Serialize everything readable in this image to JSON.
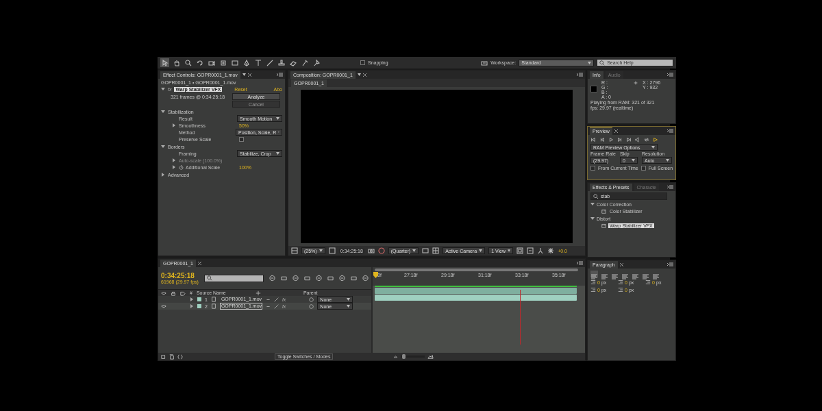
{
  "toolbar": {
    "snapping": {
      "label": "Snapping",
      "checked": false
    },
    "workspace_label": "Workspace:",
    "workspace": "Standard",
    "search": {
      "placeholder": "Search Help"
    }
  },
  "effect_controls": {
    "tab": "Effect Controls: GOPR0001_1.mov",
    "breadcrumb": "GOPR0001_1 • GOPR0001_1.mov",
    "effect_prefix": "fx",
    "effect": "Warp Stabilizer VFX",
    "reset": "Reset",
    "about": "Abo",
    "status": "321 frames @ 0:34:25:18",
    "buttons": [
      {
        "label": "Analyze",
        "disabled": false
      },
      {
        "label": "Cancel",
        "disabled": true
      }
    ],
    "properties": [
      {
        "kind": "group",
        "label": "Stabilization",
        "expanded": true,
        "disabled": false,
        "children": [
          {
            "kind": "dropdown",
            "label": "Result",
            "value": "Smooth Motion",
            "disabled": false
          },
          {
            "kind": "value",
            "label": "Smoothness",
            "value": "50%",
            "expanded": false,
            "disabled": false
          },
          {
            "kind": "dropdown",
            "label": "Method",
            "value": "Position, Scale, R",
            "disabled": false
          },
          {
            "kind": "checkbox",
            "label": "Preserve Scale",
            "checked": false,
            "disabled": false
          }
        ]
      },
      {
        "kind": "group",
        "label": "Borders",
        "expanded": true,
        "disabled": false,
        "children": [
          {
            "kind": "dropdown",
            "label": "Framing",
            "value": "Stabilize, Crop",
            "disabled": false
          },
          {
            "kind": "label",
            "label": "Auto-scale (100.0%)",
            "expanded": false,
            "disabled": true
          },
          {
            "kind": "stopwatch",
            "label": "Additional Scale",
            "value": "100%",
            "expanded": false,
            "disabled": false
          }
        ]
      },
      {
        "kind": "group",
        "label": "Advanced",
        "expanded": false,
        "disabled": false
      }
    ]
  },
  "composition": {
    "tab": "Composition: GOPR0001_1",
    "view_tab": "GOPR0001_1",
    "viewer_bar": {
      "zoom": "(25%)",
      "timecode": "0:34:25:18",
      "resolution": "(Quarter)",
      "view": "Active Camera",
      "layout": "1 View",
      "exposure": "+0.0"
    }
  },
  "info": {
    "tabs": [
      {
        "label": "Info",
        "selected": true
      },
      {
        "label": "Audio",
        "selected": false
      }
    ],
    "channels": [
      "R :",
      "G :",
      "B :",
      "A : 0"
    ],
    "coords": [
      "X : 2796",
      "Y : 932"
    ],
    "status": [
      "Playing from RAM: 321 of 321",
      "fps: 29.97 (realtime)"
    ]
  },
  "preview": {
    "tab": "Preview",
    "options": "RAM Preview Options",
    "fields": [
      {
        "label": "Frame Rate",
        "value": "(29.97)"
      },
      {
        "label": "Skip",
        "value": "0"
      },
      {
        "label": "Resolution",
        "value": "Auto"
      }
    ],
    "checks": [
      {
        "label": "From Current Time",
        "checked": false
      },
      {
        "label": "Full Screen",
        "checked": false
      }
    ]
  },
  "effects": {
    "tabs": [
      {
        "label": "Effects & Presets",
        "selected": true
      },
      {
        "label": "Characte",
        "selected": false
      }
    ],
    "search": "stab",
    "tree": [
      {
        "label": "Color Correction",
        "expanded": true,
        "children": [
          {
            "label": "Color Stabilizer",
            "selected": false
          }
        ]
      },
      {
        "label": "Distort",
        "expanded": true,
        "children": [
          {
            "label": "Warp Stabilizer VFX",
            "selected": true
          }
        ]
      }
    ]
  },
  "paragraph": {
    "tab": "Paragraph",
    "align": [
      {
        "selected": true
      },
      {
        "selected": false
      },
      {
        "selected": false
      },
      {
        "selected": false
      },
      {
        "selected": false
      },
      {
        "selected": false
      },
      {
        "selected": false
      }
    ],
    "spacing": [
      {
        "value": "0",
        "unit": "px"
      },
      {
        "value": "0",
        "unit": "px"
      },
      {
        "value": "0",
        "unit": "px"
      },
      {
        "value": "0",
        "unit": "px"
      },
      {
        "value": "0",
        "unit": "px"
      }
    ]
  },
  "timeline": {
    "tab": "GOPR0001_1",
    "timecode": "0:34:25:18",
    "frame_info": "61968 (29.97 fps)",
    "columns": [
      "#",
      "Source Name",
      "Parent"
    ],
    "layers": [
      {
        "number": "1",
        "name": "GOPR0001_1.mov",
        "effect_switch": "fx",
        "parent": "None",
        "visible": false,
        "selected": false
      },
      {
        "number": "2",
        "name": "GOPR0001_1.mov",
        "effect_switch": "fx",
        "parent": "None",
        "visible": true,
        "selected": true
      }
    ],
    "ruler": [
      "8f",
      "27:18f",
      "29:18f",
      "31:18f",
      "33:18f",
      "35:18f"
    ],
    "toggle": "Toggle Switches / Modes",
    "zoom": {
      "level": 0.1
    }
  }
}
